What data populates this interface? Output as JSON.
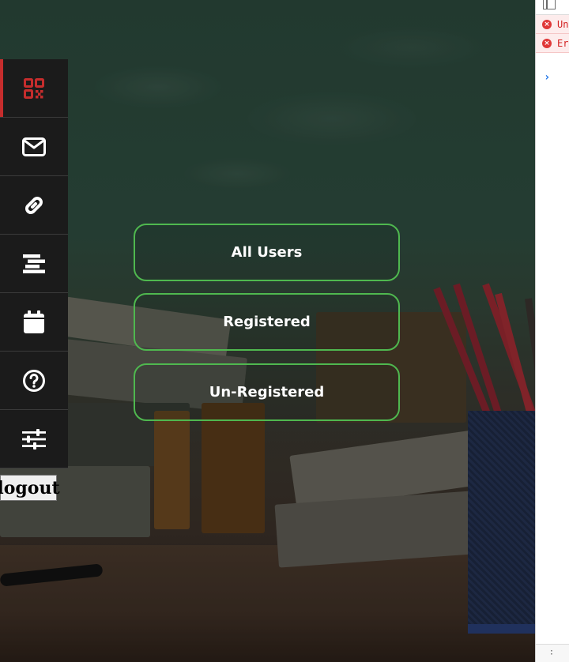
{
  "sidebar": {
    "items": [
      {
        "icon": "qr-code-icon",
        "active": true
      },
      {
        "icon": "envelope-icon",
        "active": false
      },
      {
        "icon": "link-icon",
        "active": false
      },
      {
        "icon": "align-icon",
        "active": false
      },
      {
        "icon": "calendar-icon",
        "active": false
      },
      {
        "icon": "question-circle-icon",
        "active": false
      },
      {
        "icon": "sliders-icon",
        "active": false
      }
    ],
    "logout_label": "logout"
  },
  "main": {
    "buttons": [
      {
        "label": "All Users"
      },
      {
        "label": "Registered"
      },
      {
        "label": "Un-Registered"
      }
    ]
  },
  "devtools": {
    "errors": [
      {
        "text": "Un"
      },
      {
        "text": "Er"
      }
    ],
    "prompt_symbol": "›"
  },
  "colors": {
    "active_accent": "#c62d2d",
    "button_border": "#4fb84f",
    "sidebar_bg": "#1b1b1b",
    "error_text": "#d32222"
  }
}
